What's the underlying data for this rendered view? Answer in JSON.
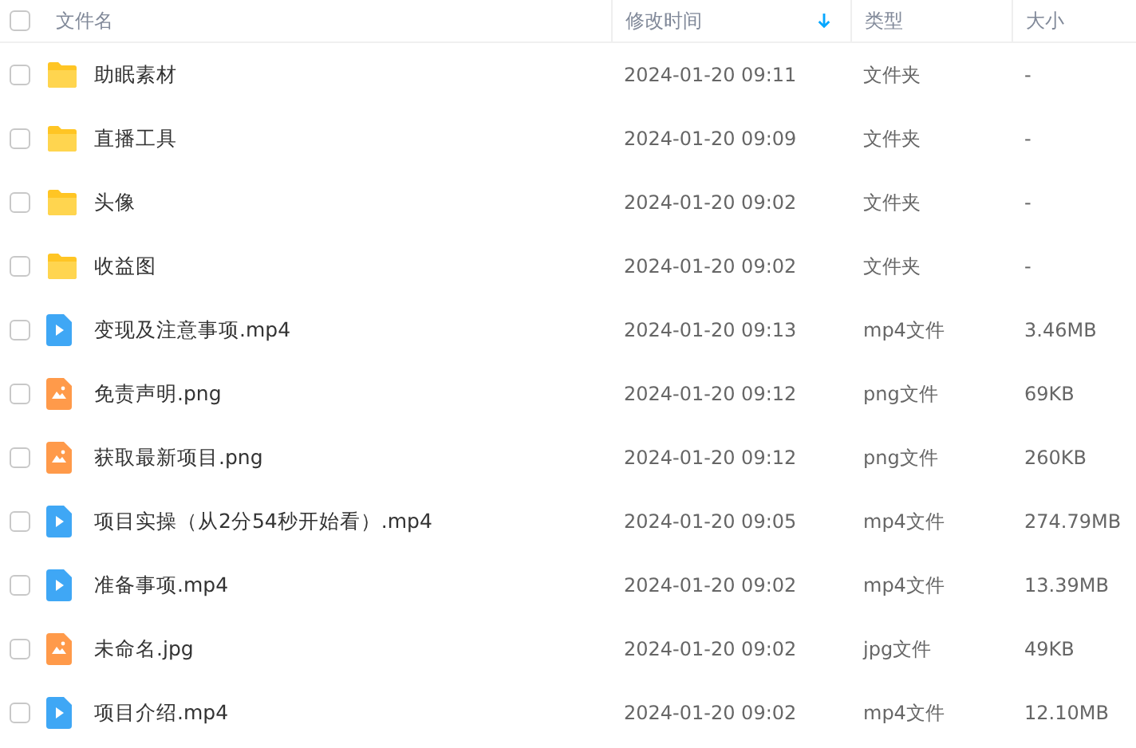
{
  "table": {
    "select_all": {
      "checked": false
    },
    "columns": [
      {
        "label": "文件名",
        "sorted": false
      },
      {
        "label": "修改时间",
        "sorted": true
      },
      {
        "label": "类型",
        "sorted": false
      },
      {
        "label": "大小",
        "sorted": false
      }
    ],
    "rows": [
      {
        "kind": "folder",
        "checked": false,
        "name": "助眠素材",
        "modified": "2024-01-20 09:11",
        "type": "文件夹",
        "size": "-"
      },
      {
        "kind": "folder",
        "checked": false,
        "name": "直播工具",
        "modified": "2024-01-20 09:09",
        "type": "文件夹",
        "size": "-"
      },
      {
        "kind": "folder",
        "checked": false,
        "name": "头像",
        "modified": "2024-01-20 09:02",
        "type": "文件夹",
        "size": "-"
      },
      {
        "kind": "folder",
        "checked": false,
        "name": "收益图",
        "modified": "2024-01-20 09:02",
        "type": "文件夹",
        "size": "-"
      },
      {
        "kind": "video",
        "checked": false,
        "name": "变现及注意事项.mp4",
        "modified": "2024-01-20 09:13",
        "type": "mp4文件",
        "size": "3.46MB"
      },
      {
        "kind": "image",
        "checked": false,
        "name": "免责声明.png",
        "modified": "2024-01-20 09:12",
        "type": "png文件",
        "size": "69KB"
      },
      {
        "kind": "image",
        "checked": false,
        "name": "获取最新项目.png",
        "modified": "2024-01-20 09:12",
        "type": "png文件",
        "size": "260KB"
      },
      {
        "kind": "video",
        "checked": false,
        "name": "项目实操（从2分54秒开始看）.mp4",
        "modified": "2024-01-20 09:05",
        "type": "mp4文件",
        "size": "274.79MB"
      },
      {
        "kind": "video",
        "checked": false,
        "name": "准备事项.mp4",
        "modified": "2024-01-20 09:02",
        "type": "mp4文件",
        "size": "13.39MB"
      },
      {
        "kind": "image",
        "checked": false,
        "name": "未命名.jpg",
        "modified": "2024-01-20 09:02",
        "type": "jpg文件",
        "size": "49KB"
      },
      {
        "kind": "video",
        "checked": false,
        "name": "项目介绍.mp4",
        "modified": "2024-01-20 09:02",
        "type": "mp4文件",
        "size": "12.10MB"
      }
    ]
  }
}
